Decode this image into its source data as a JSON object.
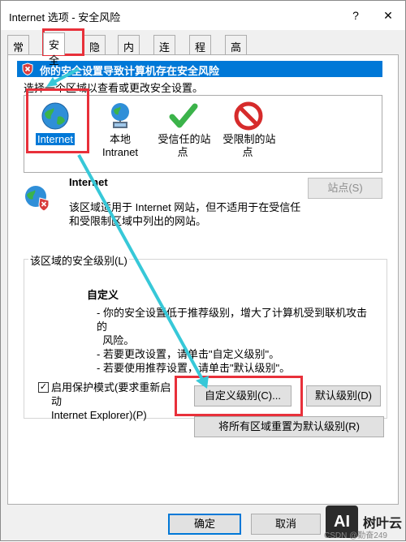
{
  "window": {
    "title": "Internet 选项 - 安全风险",
    "help_glyph": "?",
    "close_glyph": "✕"
  },
  "tabs": [
    "常规",
    "安全",
    "隐私",
    "内容",
    "连接",
    "程序",
    "高级"
  ],
  "active_tab": "安全",
  "warning": {
    "text": "你的安全设置导致计算机存在安全风险"
  },
  "zone_prompt": "选择一个区域以查看或更改安全设置。",
  "zones": [
    {
      "label": "Internet",
      "icon": "globe-icon",
      "selected": true
    },
    {
      "label_line1": "本地",
      "label_line2": "Intranet",
      "icon": "intranet-icon"
    },
    {
      "label": "受信任的站点",
      "icon": "checkmark-icon"
    },
    {
      "label": "受限制的站点",
      "icon": "no-entry-icon"
    }
  ],
  "selected_zone": {
    "title": "Internet",
    "desc_line1": "该区域适用于 Internet 网站，但不适用于在受信任",
    "desc_line2": "和受限制区域中列出的网站。",
    "sites_button": "站点(S)"
  },
  "security_level": {
    "group_label": "该区域的安全级别(L)",
    "level_name": "自定义",
    "lines": [
      "- 你的安全设置低于推荐级别，增大了计算机受到联机攻击的",
      "  风险。",
      "- 若要更改设置，请单击\"自定义级别\"。",
      "- 若要使用推荐设置，请单击\"默认级别\"。"
    ],
    "protected_mode_line1": "启用保护模式(要求重新启动",
    "protected_mode_line2": "Internet Explorer)(P)",
    "protected_mode_checked": true,
    "custom_level_button": "自定义级别(C)...",
    "default_level_button": "默认级别(D)",
    "reset_all_button": "将所有区域重置为默认级别(R)"
  },
  "footer": {
    "ok": "确定",
    "cancel": "取消"
  },
  "watermark": {
    "logo": "AI",
    "text": "树叶云",
    "sub": "CSDN @勤奋249"
  },
  "colors": {
    "accent": "#0078d7",
    "highlight": "#e8303a",
    "arrow": "#37c8d8"
  }
}
